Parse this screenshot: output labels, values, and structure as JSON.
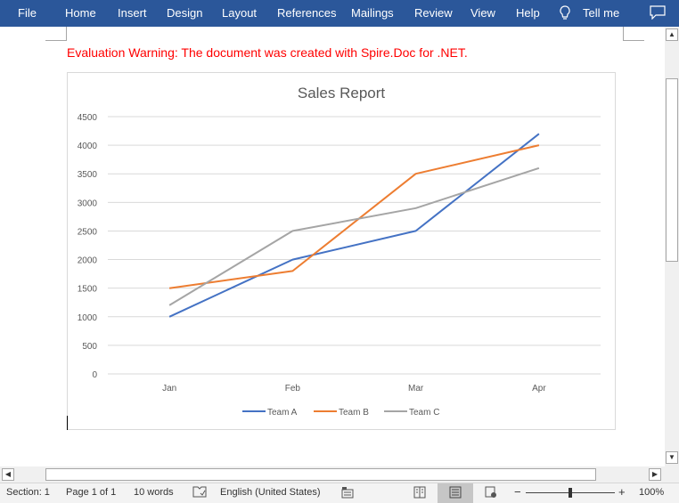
{
  "ribbon": {
    "tabs": [
      "File",
      "Home",
      "Insert",
      "Design",
      "Layout",
      "References",
      "Mailings",
      "Review",
      "View",
      "Help"
    ],
    "tell_me": "Tell me",
    "icons": {
      "tell_me": "lightbulb-icon",
      "comments": "comment-icon"
    },
    "color": "#2b579a"
  },
  "document": {
    "warning": "Evaluation Warning: The document was created with Spire.Doc for .NET.",
    "warning_color": "#ff0000"
  },
  "chart_data": {
    "type": "line",
    "title": "Sales Report",
    "categories": [
      "Jan",
      "Feb",
      "Mar",
      "Apr"
    ],
    "series": [
      {
        "name": "Team A",
        "color": "#4472c4",
        "values": [
          1000,
          2000,
          2500,
          4200
        ]
      },
      {
        "name": "Team B",
        "color": "#ed7d31",
        "values": [
          1500,
          1800,
          3500,
          4000
        ]
      },
      {
        "name": "Team C",
        "color": "#a5a5a5",
        "values": [
          1200,
          2500,
          2900,
          3600
        ]
      }
    ],
    "yticks": [
      0,
      500,
      1000,
      1500,
      2000,
      2500,
      3000,
      3500,
      4000,
      4500
    ],
    "ylim": [
      0,
      4500
    ],
    "xlabel": "",
    "ylabel": "",
    "grid": true,
    "legend": "bottom"
  },
  "status": {
    "section": "Section: 1",
    "page": "Page 1 of 1",
    "words": "10 words",
    "language": "English (United States)",
    "zoom_minus": "−",
    "zoom_plus": "+",
    "zoom": "100%",
    "zoom_level_percent": 100
  },
  "scrollbar": {
    "up": "▲",
    "down": "▼",
    "left": "◀",
    "right": "▶"
  }
}
